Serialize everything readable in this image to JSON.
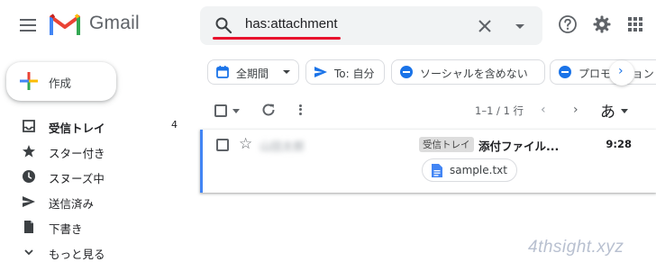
{
  "app": {
    "name": "Gmail"
  },
  "search": {
    "query": "has:attachment"
  },
  "sidebar": {
    "compose_label": "作成",
    "items": [
      {
        "label": "受信トレイ",
        "count": "4",
        "bold": true,
        "icon": "inbox-icon"
      },
      {
        "label": "スター付き",
        "icon": "star-icon"
      },
      {
        "label": "スヌーズ中",
        "icon": "clock-icon"
      },
      {
        "label": "送信済み",
        "icon": "send-icon"
      },
      {
        "label": "下書き",
        "icon": "draft-icon"
      },
      {
        "label": "もっと見る",
        "icon": "chevron-down-icon"
      }
    ]
  },
  "chips": [
    {
      "label": "全期間",
      "icon": "calendar-icon",
      "has_dropdown": true
    },
    {
      "label": "To: 自分",
      "icon": "send-icon"
    },
    {
      "label": "ソーシャルを含めない",
      "icon": "minus-circle-icon"
    },
    {
      "label": "プロモーション",
      "icon": "minus-circle-icon"
    }
  ],
  "toolbar": {
    "pagination": "1–1 / 1 行",
    "input_mode": "あ"
  },
  "emails": [
    {
      "sender": "山田太郎",
      "badge": "受信トレイ",
      "subject": "添付ファイル...",
      "time": "9:28",
      "attachment": "sample.txt"
    }
  ],
  "watermark": "4thsight.xyz",
  "colors": {
    "accent": "#1a73e8",
    "search_bg": "#f1f3f4",
    "underline": "#e8112d",
    "selected_border": "#4285f4"
  }
}
